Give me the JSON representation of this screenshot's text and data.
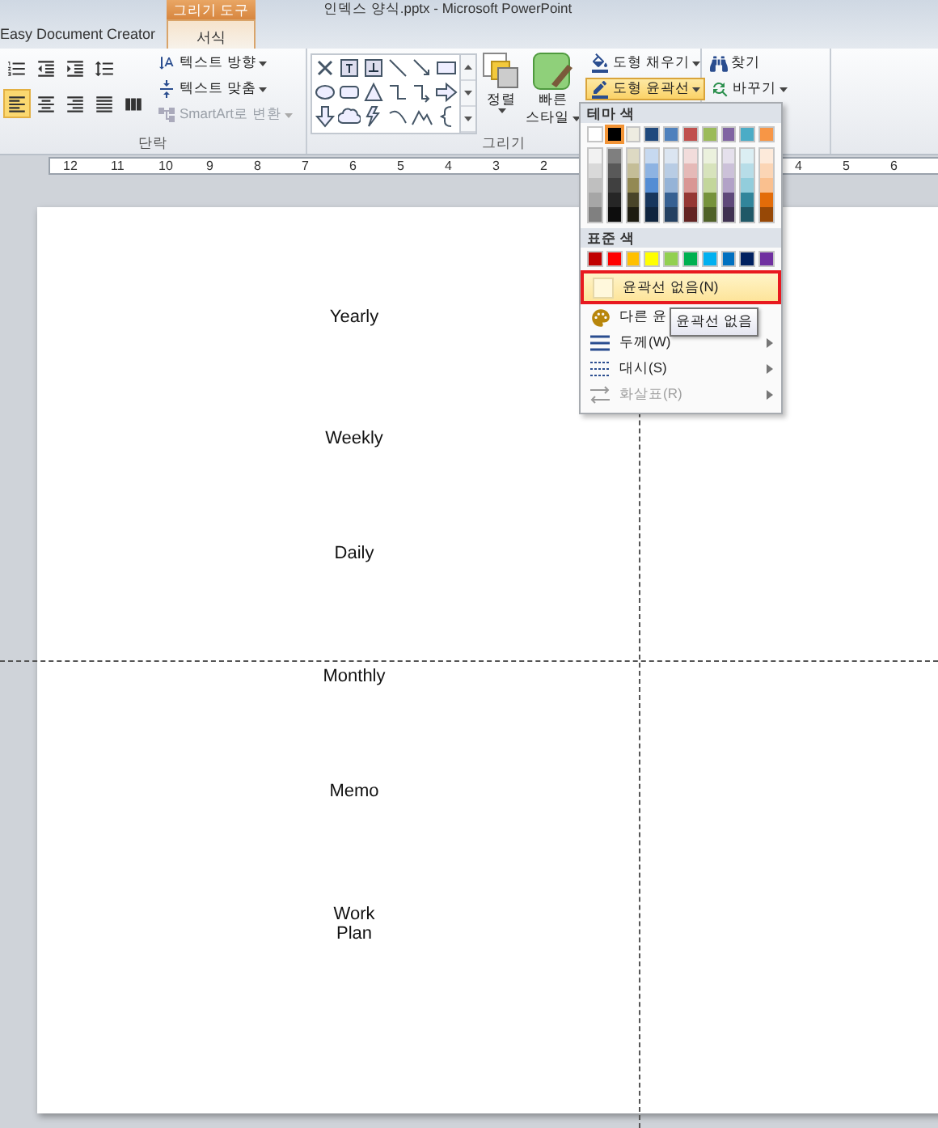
{
  "window": {
    "title": "인덱스 양식.pptx - Microsoft PowerPoint"
  },
  "tabs": [
    {
      "label": "Easy Document Creator",
      "selected": false
    },
    {
      "label": "서식",
      "selected": true
    }
  ],
  "context_tab": {
    "label": "그리기 도구"
  },
  "paragraph_group": {
    "label": "단락",
    "align_buttons": [
      {
        "selected": true
      },
      {
        "selected": false
      },
      {
        "selected": false
      },
      {
        "selected": false
      }
    ],
    "commands": [
      {
        "label": "텍스트 방향",
        "disabled": false
      },
      {
        "label": "텍스트 맞춤",
        "disabled": false
      },
      {
        "label": "SmartArt로 변환",
        "disabled": true
      }
    ]
  },
  "drawing_group": {
    "label": "그리기",
    "arrange": "정렬",
    "quick_styles": [
      "빠른",
      "스타일"
    ],
    "commands": [
      {
        "label": "도형 채우기",
        "selected": false
      },
      {
        "label": "도형 윤곽선",
        "selected": true
      }
    ]
  },
  "editing_group": {
    "commands": [
      "찾기",
      "바꾸기"
    ]
  },
  "ruler": {
    "left_labels": [
      "12",
      "11",
      "10",
      "9",
      "8",
      "7",
      "6",
      "5",
      "4",
      "3",
      "2"
    ],
    "right_labels": [
      "4",
      "5",
      "6"
    ]
  },
  "outline_menu": {
    "theme_heading": "테마 색",
    "standard_heading": "표준 색",
    "theme_colors": [
      {
        "color": "#ffffff",
        "selected": false,
        "shades": [
          {
            "color": "#f2f2f2"
          },
          {
            "color": "#d9d9d9"
          },
          {
            "color": "#bfbfbf"
          },
          {
            "color": "#a6a6a6"
          },
          {
            "color": "#808080"
          }
        ]
      },
      {
        "color": "#000000",
        "selected": true,
        "shades": [
          {
            "color": "#7f7f7f"
          },
          {
            "color": "#595959"
          },
          {
            "color": "#404040"
          },
          {
            "color": "#262626"
          },
          {
            "color": "#0d0d0d"
          }
        ]
      },
      {
        "color": "#eeece1",
        "selected": false,
        "shades": [
          {
            "color": "#ddd9c3"
          },
          {
            "color": "#c4bd97"
          },
          {
            "color": "#938953"
          },
          {
            "color": "#494429"
          },
          {
            "color": "#1d1b10"
          }
        ]
      },
      {
        "color": "#1f497d",
        "selected": false,
        "shades": [
          {
            "color": "#c6d9f0"
          },
          {
            "color": "#8db3e2"
          },
          {
            "color": "#548dd4"
          },
          {
            "color": "#17365d"
          },
          {
            "color": "#0f243e"
          }
        ]
      },
      {
        "color": "#4f81bd",
        "selected": false,
        "shades": [
          {
            "color": "#dbe5f1"
          },
          {
            "color": "#b8cce4"
          },
          {
            "color": "#95b3d7"
          },
          {
            "color": "#366092"
          },
          {
            "color": "#244061"
          }
        ]
      },
      {
        "color": "#c0504d",
        "selected": false,
        "shades": [
          {
            "color": "#f2dcdb"
          },
          {
            "color": "#e5b9b7"
          },
          {
            "color": "#d99694"
          },
          {
            "color": "#953734"
          },
          {
            "color": "#632423"
          }
        ]
      },
      {
        "color": "#9bbb59",
        "selected": false,
        "shades": [
          {
            "color": "#ebf1dd"
          },
          {
            "color": "#d7e3bc"
          },
          {
            "color": "#c3d69b"
          },
          {
            "color": "#76923c"
          },
          {
            "color": "#4f6128"
          }
        ]
      },
      {
        "color": "#8064a2",
        "selected": false,
        "shades": [
          {
            "color": "#e5e0ec"
          },
          {
            "color": "#ccc1d9"
          },
          {
            "color": "#b2a2c7"
          },
          {
            "color": "#5f497a"
          },
          {
            "color": "#3f3151"
          }
        ]
      },
      {
        "color": "#4bacc6",
        "selected": false,
        "shades": [
          {
            "color": "#dbeef3"
          },
          {
            "color": "#b7dde8"
          },
          {
            "color": "#92cddc"
          },
          {
            "color": "#31859b"
          },
          {
            "color": "#205867"
          }
        ]
      },
      {
        "color": "#f79646",
        "selected": false,
        "shades": [
          {
            "color": "#fdeada"
          },
          {
            "color": "#fbd5b5"
          },
          {
            "color": "#fac08f"
          },
          {
            "color": "#e36c09"
          },
          {
            "color": "#974806"
          }
        ]
      }
    ],
    "standard_colors": [
      {
        "color": "#c00000"
      },
      {
        "color": "#ff0000"
      },
      {
        "color": "#ffc000"
      },
      {
        "color": "#ffff00"
      },
      {
        "color": "#92d050"
      },
      {
        "color": "#00b050"
      },
      {
        "color": "#00b0f0"
      },
      {
        "color": "#0070c0"
      },
      {
        "color": "#002060"
      },
      {
        "color": "#7030a0"
      }
    ],
    "items": [
      {
        "kind": "none",
        "label": "윤곽선 없음(N)",
        "selected": true,
        "disabled": false,
        "submenu": false
      },
      {
        "kind": "more_colors",
        "label": "다른 윤",
        "selected": false,
        "disabled": false,
        "submenu": false
      },
      {
        "kind": "weight",
        "label": "두께(W)",
        "selected": false,
        "disabled": false,
        "submenu": true
      },
      {
        "kind": "dash",
        "label": "대시(S)",
        "selected": false,
        "disabled": false,
        "submenu": true
      },
      {
        "kind": "arrows",
        "label": "화살표(R)",
        "selected": false,
        "disabled": true,
        "submenu": true
      }
    ]
  },
  "tooltip": {
    "text": "윤곽선 없음"
  },
  "slide": {
    "labels": [
      "Yearly",
      "Weekly",
      "Daily",
      "Monthly",
      "Memo",
      "Work\nPlan"
    ]
  }
}
